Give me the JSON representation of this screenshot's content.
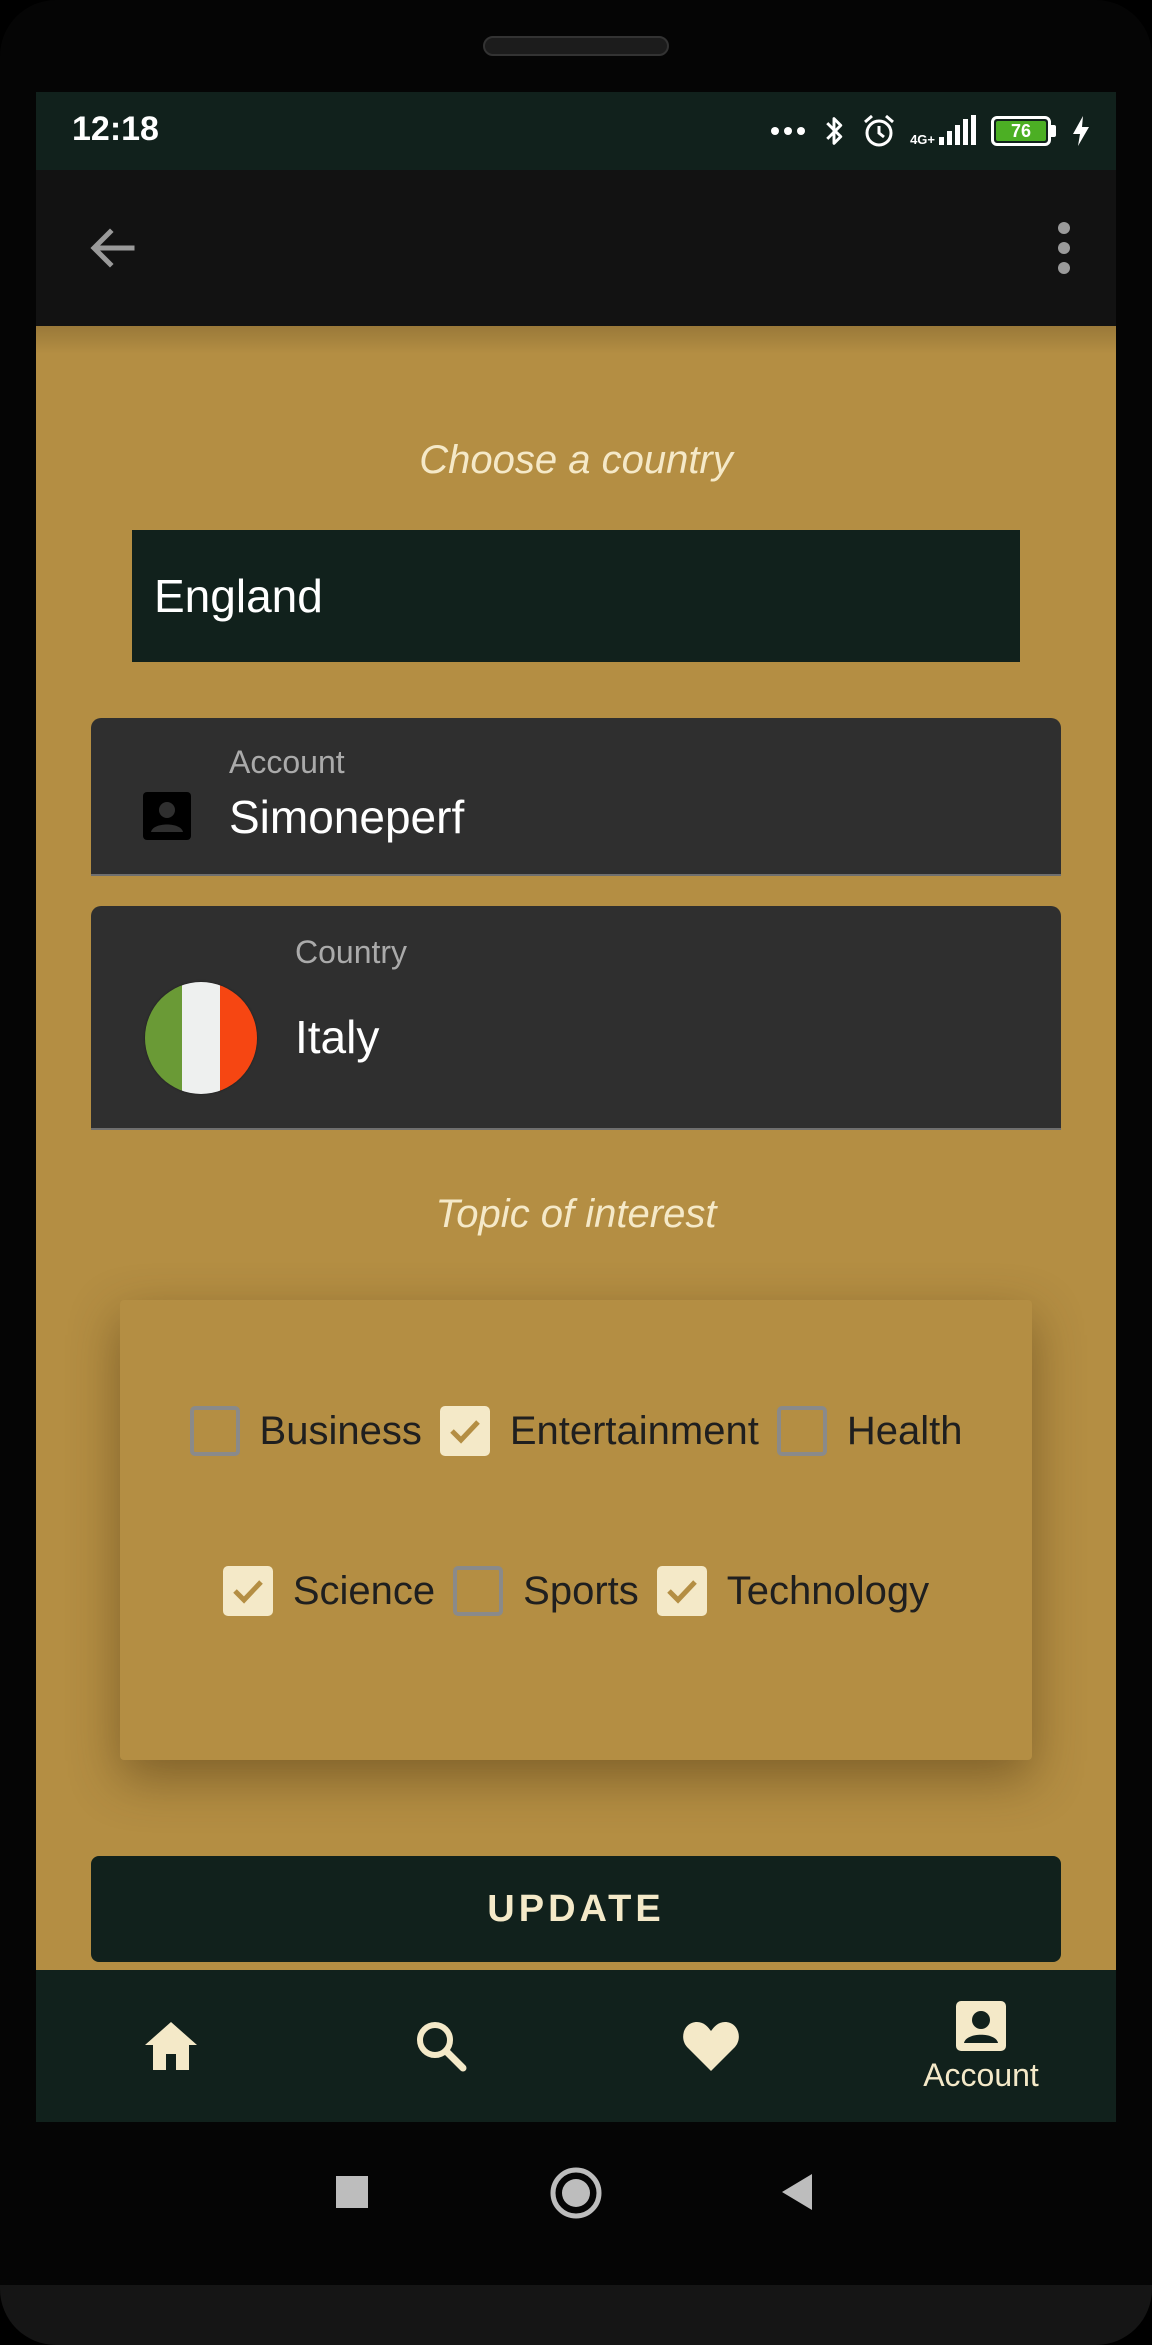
{
  "status_bar": {
    "time": "12:18",
    "network": "4G+",
    "battery": "76"
  },
  "toolbar": {
    "back_icon": "arrow-back-icon",
    "menu_icon": "more-vert-icon"
  },
  "choose_country": {
    "title": "Choose a country",
    "selected": "England"
  },
  "account": {
    "label": "Account",
    "value": "Simoneperf",
    "icon": "account-box-icon"
  },
  "country": {
    "label": "Country",
    "value": "Italy",
    "flag_colors": [
      "#6a9a36",
      "#eef0ef",
      "#f64612"
    ]
  },
  "topics": {
    "title": "Topic of interest",
    "row1": [
      {
        "label": "Business",
        "checked": false
      },
      {
        "label": "Entertainment",
        "checked": true
      },
      {
        "label": "Health",
        "checked": false
      }
    ],
    "row2": [
      {
        "label": "Science",
        "checked": true
      },
      {
        "label": "Sports",
        "checked": false
      },
      {
        "label": "Technology",
        "checked": true
      }
    ]
  },
  "update_button": "UPDATE",
  "bottom_nav": {
    "items": [
      {
        "icon": "home-icon",
        "label": ""
      },
      {
        "icon": "search-icon",
        "label": ""
      },
      {
        "icon": "favorite-icon",
        "label": ""
      },
      {
        "icon": "account-icon",
        "label": "Account",
        "active": true
      }
    ]
  },
  "colors": {
    "background": "#b48e43",
    "dark": "#11211c",
    "field": "#2f2f2f",
    "cream": "#f4e9c8"
  }
}
